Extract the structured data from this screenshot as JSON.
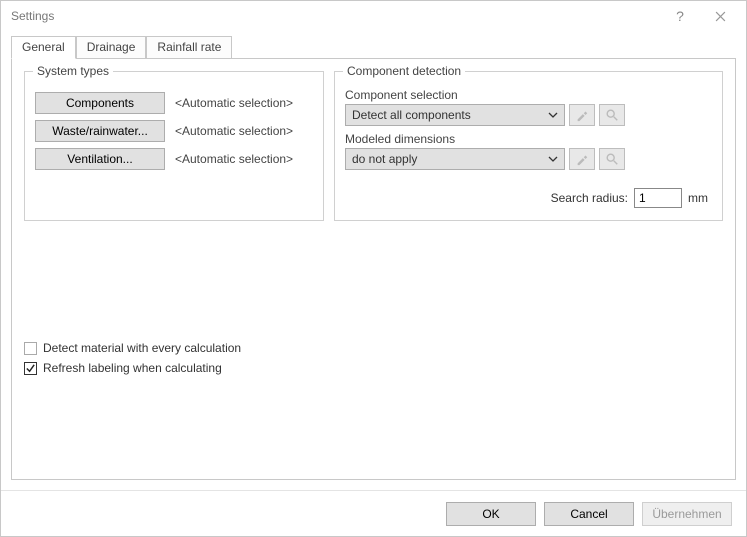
{
  "window": {
    "title": "Settings"
  },
  "tabs": {
    "general": "General",
    "drainage": "Drainage",
    "rainfall": "Rainfall rate"
  },
  "groups": {
    "system_types": {
      "legend": "System types",
      "components_btn": "Components",
      "waste_btn": "Waste/rainwater...",
      "ventilation_btn": "Ventilation...",
      "auto_label": "<Automatic selection>"
    },
    "component_detection": {
      "legend": "Component detection",
      "component_selection_label": "Component selection",
      "component_selection_value": "Detect all components",
      "modeled_dimensions_label": "Modeled dimensions",
      "modeled_dimensions_value": "do not apply",
      "search_radius_label": "Search radius:",
      "search_radius_value": "1",
      "search_radius_unit": "mm"
    }
  },
  "checkboxes": {
    "detect_material": "Detect material with every calculation",
    "refresh_labeling": "Refresh labeling when calculating"
  },
  "buttons": {
    "ok": "OK",
    "cancel": "Cancel",
    "apply": "Übernehmen"
  }
}
